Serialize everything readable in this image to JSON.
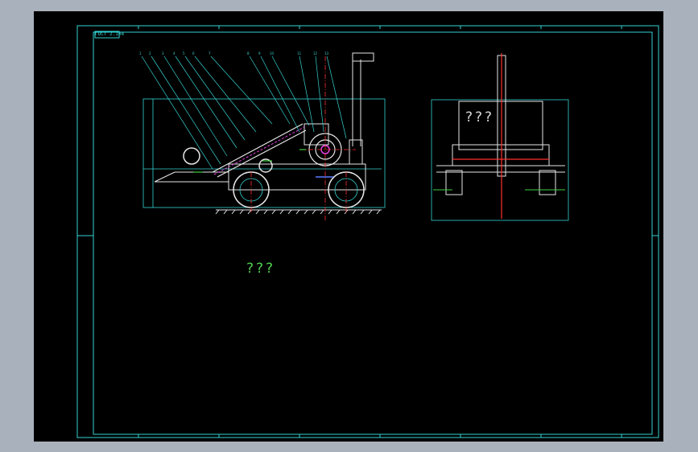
{
  "drawing": {
    "side_view_label": "???",
    "plan_view_label": "???",
    "frame_label": "ГОСТ 2.104"
  },
  "colors": {
    "background_outer": "#a9b1bc",
    "canvas": "#000000",
    "border": "#35d2d2",
    "line_white": "#e6e6e6",
    "line_red": "#ff3030",
    "line_magenta": "#e040e0",
    "line_green": "#40d040",
    "line_blue": "#5a7bff",
    "line_yellow": "#e8e84a",
    "label_green": "#4fd04f"
  }
}
